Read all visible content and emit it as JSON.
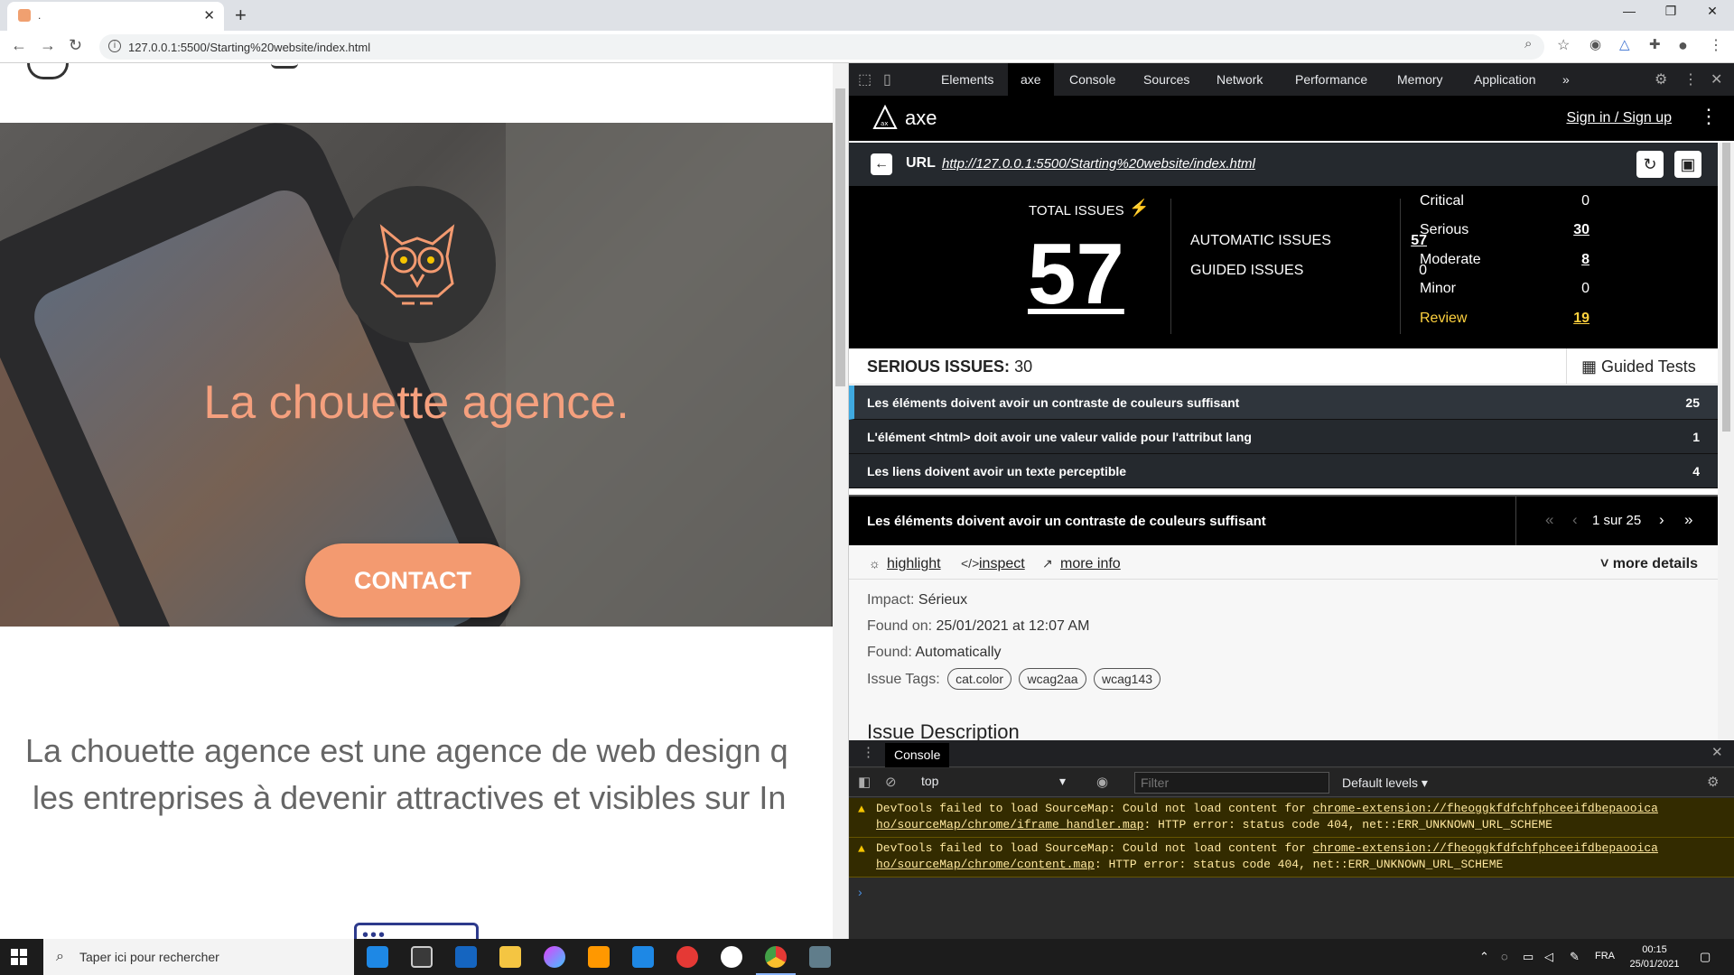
{
  "browser": {
    "tab_title": ".",
    "url": "127.0.0.1:5500/Starting%20website/index.html"
  },
  "site": {
    "hero_title": "La chouette agence.",
    "contact_label": "CONTACT",
    "intro_line1": "La chouette agence est une agence de web design q",
    "intro_line2": "les entreprises à devenir attractives et visibles sur In"
  },
  "devtools": {
    "tabs": [
      "Elements",
      "axe",
      "Console",
      "Sources",
      "Network",
      "Performance",
      "Memory",
      "Application"
    ],
    "more_tabs": "»"
  },
  "axe": {
    "brand": "axe",
    "signin": "Sign in / Sign up",
    "url_label": "URL",
    "url": "http://127.0.0.1:5500/Starting%20website/index.html",
    "total_label": "TOTAL ISSUES",
    "total": "57",
    "automatic_label": "AUTOMATIC ISSUES",
    "automatic": "57",
    "guided_label": "GUIDED ISSUES",
    "guided": "0",
    "severity": {
      "critical_label": "Critical",
      "critical": "0",
      "serious_label": "Serious",
      "serious": "30",
      "moderate_label": "Moderate",
      "moderate": "8",
      "minor_label": "Minor",
      "minor": "0",
      "review_label": "Review",
      "review": "19"
    },
    "serious_title_bold": "SERIOUS ISSUES:",
    "serious_title_count": "30",
    "guided_tests": "Guided Tests",
    "issues": [
      {
        "text": "Les éléments doivent avoir un contraste de couleurs suffisant",
        "count": "25"
      },
      {
        "text": "L'élément <html> doit avoir une valeur valide pour l'attribut lang",
        "count": "1"
      },
      {
        "text": "Les liens doivent avoir un texte perceptible",
        "count": "4"
      }
    ],
    "current_issue": "Les éléments doivent avoir un contraste de couleurs suffisant",
    "pager": "1 sur 25",
    "actions": {
      "highlight": "highlight",
      "inspect": "inspect",
      "more_info": "more info",
      "more_details": "more details"
    },
    "impact_label": "Impact:",
    "impact": "Sérieux",
    "found_on_label": "Found on:",
    "found_on": "25/01/2021 at 12:07 AM",
    "found_label": "Found:",
    "found": "Automatically",
    "tags_label": "Issue Tags:",
    "tags": [
      "cat.color",
      "wcag2aa",
      "wcag143"
    ],
    "description_heading": "Issue Description"
  },
  "console": {
    "tab": "Console",
    "context": "top",
    "filter_placeholder": "Filter",
    "levels": "Default levels",
    "warnings": [
      {
        "pre": "DevTools failed to load SourceMap: Could not load content for ",
        "link": "chrome-extension://fheoggkfdfchfphceeifdbepaooica ho/sourceMap/chrome/iframe_handler.map",
        "post": ": HTTP error: status code 404, net::ERR_UNKNOWN_URL_SCHEME"
      },
      {
        "pre": "DevTools failed to load SourceMap: Could not load content for ",
        "link": "chrome-extension://fheoggkfdfchfphceeifdbepaooica ho/sourceMap/chrome/content.map",
        "post": ": HTTP error: status code 404, net::ERR_UNKNOWN_URL_SCHEME"
      }
    ]
  },
  "taskbar": {
    "search_placeholder": "Taper ici pour rechercher",
    "language": "FRA",
    "time": "00:15",
    "date": "25/01/2021"
  }
}
